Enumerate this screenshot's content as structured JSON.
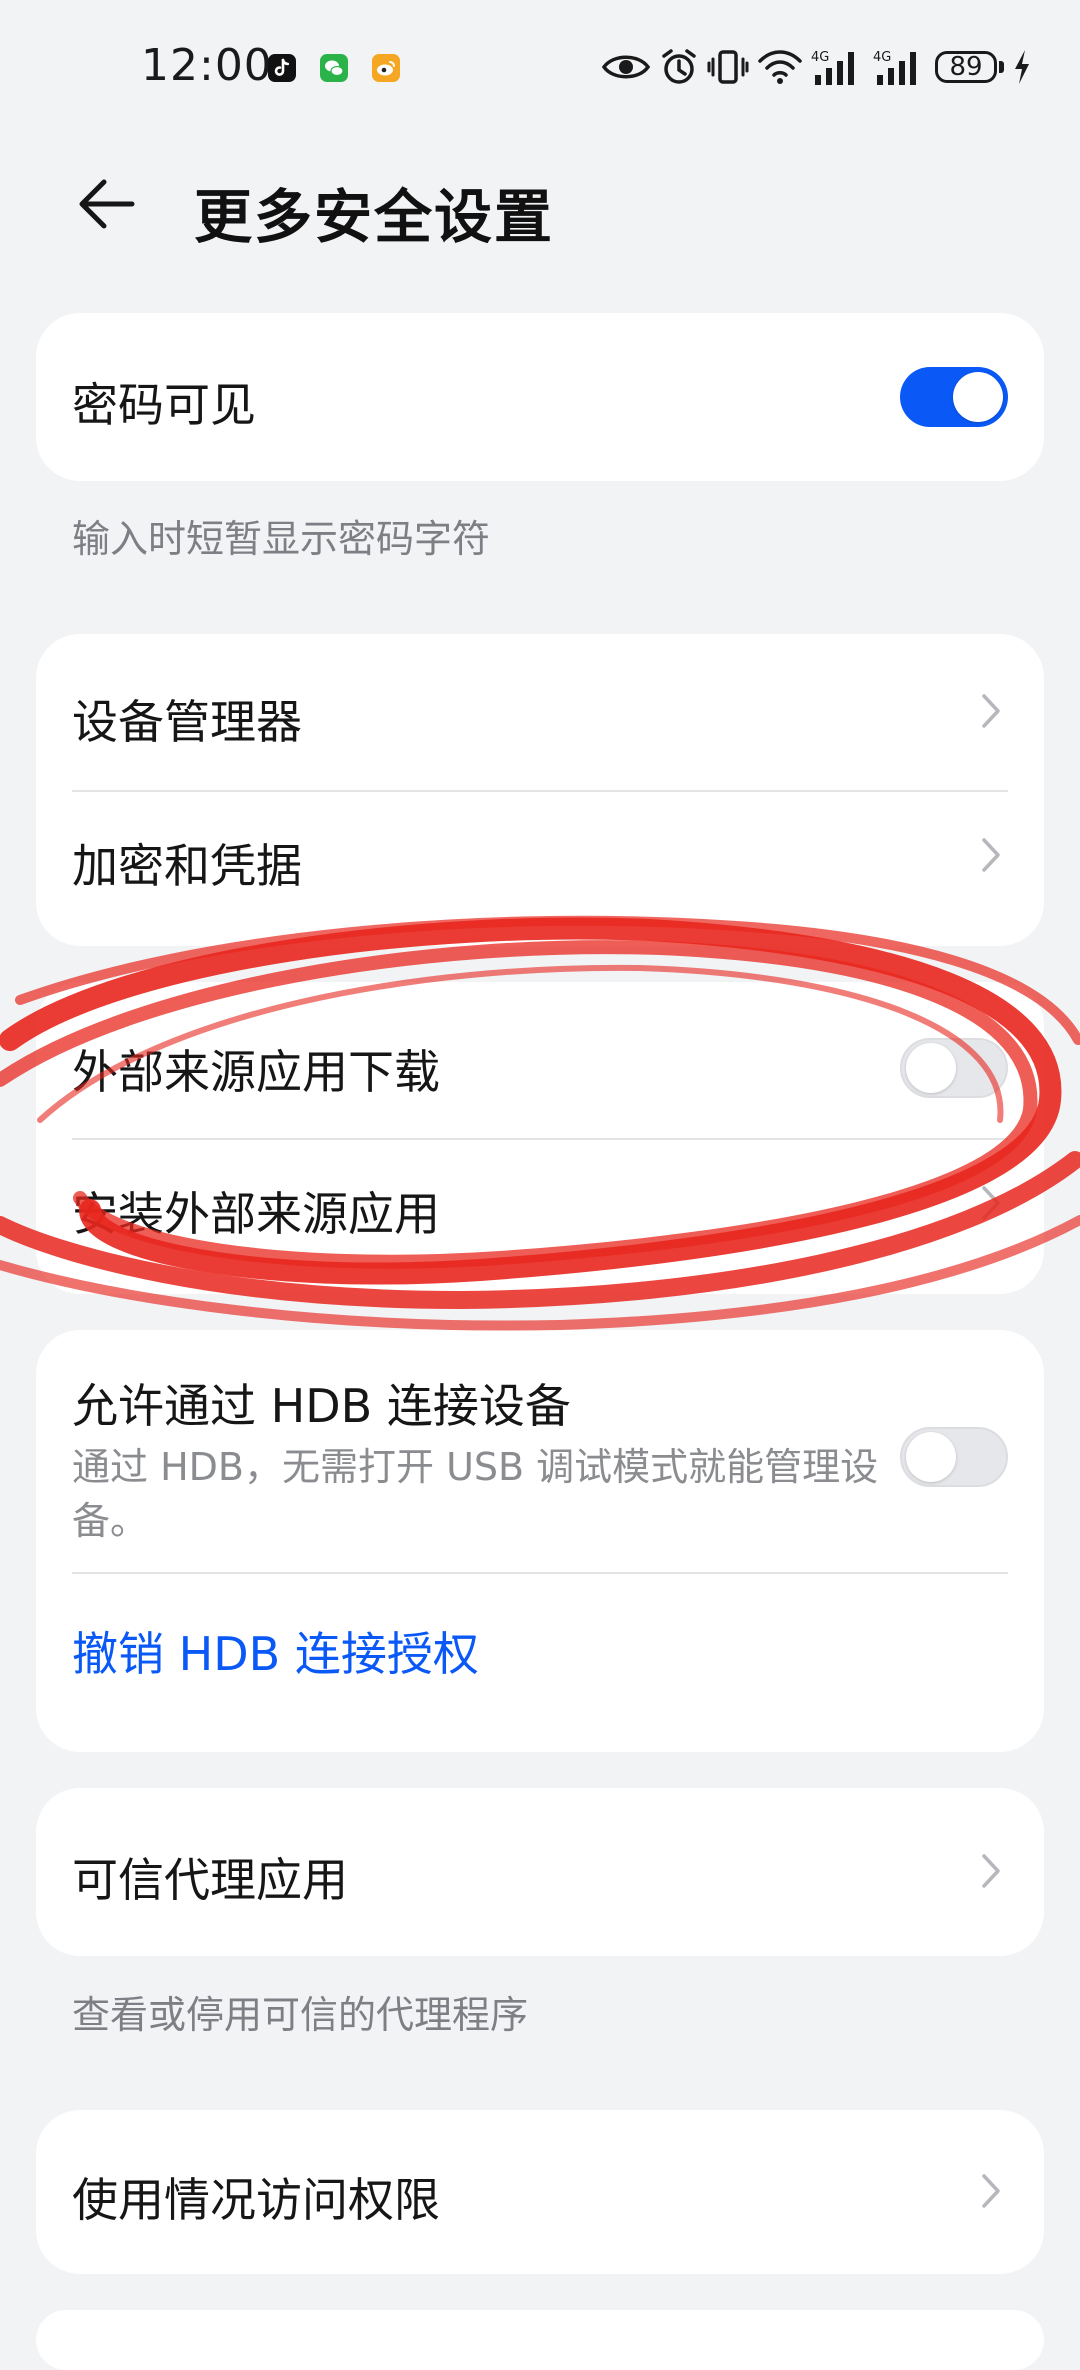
{
  "status_bar": {
    "time": "12:00",
    "battery_level": "89",
    "app_icons": [
      "tiktok-icon",
      "wechat-icon",
      "weibo-icon"
    ],
    "status_icons": [
      "eye-icon",
      "alarm-icon",
      "vibrate-icon",
      "wifi-icon",
      "signal-4g-icon",
      "signal-4g-icon",
      "battery-icon",
      "charging-icon"
    ]
  },
  "header": {
    "title": "更多安全设置"
  },
  "password_card": {
    "label": "密码可见",
    "toggle_on": true
  },
  "password_hint": "输入时短暂显示密码字符",
  "device_card": {
    "items": [
      {
        "label": "设备管理器"
      },
      {
        "label": "加密和凭据"
      }
    ]
  },
  "external_card": {
    "download_label": "外部来源应用下载",
    "download_toggle_on": false,
    "install_label": "安装外部来源应用"
  },
  "hdb_card": {
    "label": "允许通过 HDB 连接设备",
    "sublabel": "通过 HDB，无需打开 USB 调试模式就能管理设备。",
    "toggle_on": false,
    "revoke_label": "撤销 HDB 连接授权"
  },
  "trust_card": {
    "label": "可信代理应用"
  },
  "trust_hint": "查看或停用可信的代理程序",
  "usage_card": {
    "label": "使用情况访问权限"
  },
  "colors": {
    "accent": "#0a59f7",
    "background": "#f1f3f5",
    "card": "#ffffff",
    "annotation": "#e8271e"
  }
}
